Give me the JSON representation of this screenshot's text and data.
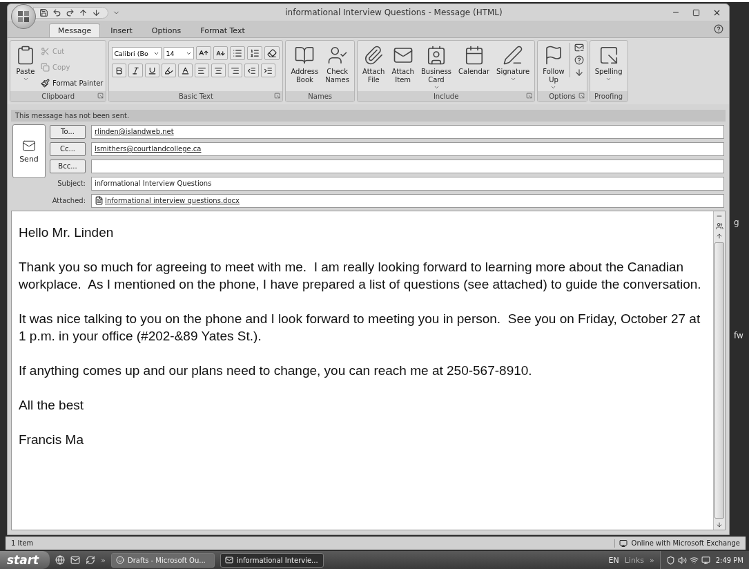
{
  "window": {
    "title": "informational Interview Questions - Message (HTML)"
  },
  "tabs": [
    {
      "label": "Message",
      "selected": true
    },
    {
      "label": "Insert",
      "selected": false
    },
    {
      "label": "Options",
      "selected": false
    },
    {
      "label": "Format Text",
      "selected": false
    }
  ],
  "ribbon": {
    "groups": [
      {
        "kind": "clipboard",
        "name": "Clipboard",
        "launcher": true,
        "paste": {
          "label": "Paste",
          "dropdown": true
        },
        "small": [
          {
            "label": "Cut",
            "disabled": true
          },
          {
            "label": "Copy",
            "disabled": true
          },
          {
            "label": "Format Painter",
            "disabled": false
          }
        ]
      },
      {
        "kind": "font",
        "name": "Basic Text",
        "launcher": true,
        "font_name": "Calibri (Bo",
        "font_size": "14"
      },
      {
        "kind": "buttons",
        "name": "Names",
        "launcher": false,
        "buttons": [
          {
            "lines": [
              "Address",
              "Book"
            ],
            "dropdown": false
          },
          {
            "lines": [
              "Check",
              "Names"
            ],
            "dropdown": false
          }
        ]
      },
      {
        "kind": "buttons",
        "name": "Include",
        "launcher": true,
        "buttons": [
          {
            "lines": [
              "Attach",
              "File"
            ],
            "dropdown": false
          },
          {
            "lines": [
              "Attach",
              "Item"
            ],
            "dropdown": false
          },
          {
            "lines": [
              "Business",
              "Card"
            ],
            "dropdown": true
          },
          {
            "lines": [
              "Calendar"
            ],
            "dropdown": false
          },
          {
            "lines": [
              "Signature"
            ],
            "dropdown": true
          }
        ]
      },
      {
        "kind": "options",
        "name": "Options",
        "launcher": true,
        "buttons": [
          {
            "lines": [
              "Follow",
              "Up"
            ],
            "dropdown": true
          }
        ]
      },
      {
        "kind": "buttons",
        "name": "Proofing",
        "launcher": false,
        "buttons": [
          {
            "lines": [
              "Spelling"
            ],
            "dropdown": true
          }
        ]
      }
    ]
  },
  "info_bar": "This message has not been sent.",
  "send_button": "Send",
  "fields": [
    {
      "kind": "address",
      "button": "To...",
      "value": "rlinden@islandweb.net"
    },
    {
      "kind": "address",
      "button": "Cc...",
      "value": "lsmithers@courtlandcollege.ca"
    },
    {
      "kind": "address",
      "button": "Bcc..."
    },
    {
      "kind": "subject",
      "label": "Subject:",
      "value": "informational Interview Questions"
    },
    {
      "kind": "attachment",
      "label": "Attached:",
      "value": "Informational interview questions.docx"
    }
  ],
  "body": [
    "Hello Mr. Linden",
    "Thank you so much for agreeing to meet with me.  I am really looking forward to learning more about the Canadian workplace.  As I mentioned on the phone, I have prepared a list of questions (see attached) to guide the conversation.",
    "It was nice talking to you on the phone and I look forward to meeting you in person.  See you on Friday, October 27 at 1 p.m. in your office (#202-&89 Yates St.).",
    "If anything comes up and our plans need to change, you can reach me at 250-567-8910.",
    "All the best",
    "Francis Ma"
  ],
  "status_bar": {
    "left": "1 Item",
    "right": "Online with Microsoft Exchange"
  },
  "desktop_fragments": [
    "g",
    "fw"
  ],
  "taskbar": {
    "start": "start",
    "chevron": "»",
    "tasks": [
      {
        "label": "Drafts - Microsoft Ou...",
        "selected": false
      },
      {
        "label": "informational Intervie...",
        "selected": true
      }
    ],
    "language": "EN",
    "links": "Links",
    "links_chevron": "»",
    "clock": "2:49 PM"
  }
}
